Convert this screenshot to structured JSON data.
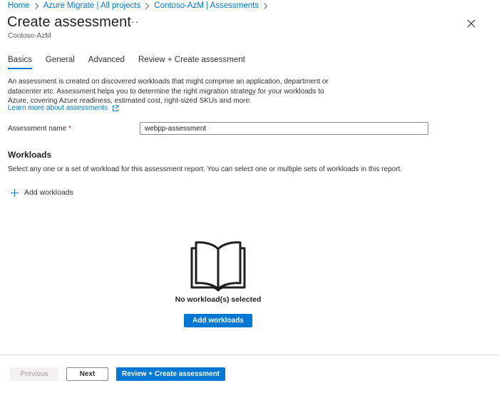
{
  "breadcrumb": [
    "Home",
    "Azure Migrate | All projects",
    "Contoso-AzM | Assessments"
  ],
  "header": {
    "title": "Create assessment",
    "more_label": "···",
    "subtitle": "Contoso-AzM"
  },
  "tabs": [
    {
      "label": "Basics",
      "active": true
    },
    {
      "label": "General",
      "active": false
    },
    {
      "label": "Advanced",
      "active": false
    },
    {
      "label": "Review + Create assessment",
      "active": false
    }
  ],
  "basics": {
    "description": "An assessment is created on discovered workloads that might comprise an application, department or datacenter etc. Assessment helps you to determine the right migration strategy for your workloads to Azure, covering Azure readiness, estimated cost, right-sized SKUs and more.",
    "learn_more": "Learn more about assessments",
    "name_label": "Assessment name",
    "required_marker": "*",
    "name_value": "webpp-assessment"
  },
  "workloads": {
    "heading": "Workloads",
    "description": "Select any one or a set of workload for this assessment report. You can select one or multiple sets of workloads in this report.",
    "add_label": "Add workloads",
    "empty_text": "No workload(s) selected",
    "empty_button": "Add workloads"
  },
  "footer": {
    "previous": "Previous",
    "next": "Next",
    "review": "Review + Create assessment"
  },
  "colors": {
    "accent": "#0078d4",
    "text": "#323130",
    "required": "#a4262c"
  },
  "icons": [
    "chevron-right-icon",
    "more-icon",
    "close-icon",
    "external-link-icon",
    "plus-icon",
    "open-book-icon"
  ]
}
